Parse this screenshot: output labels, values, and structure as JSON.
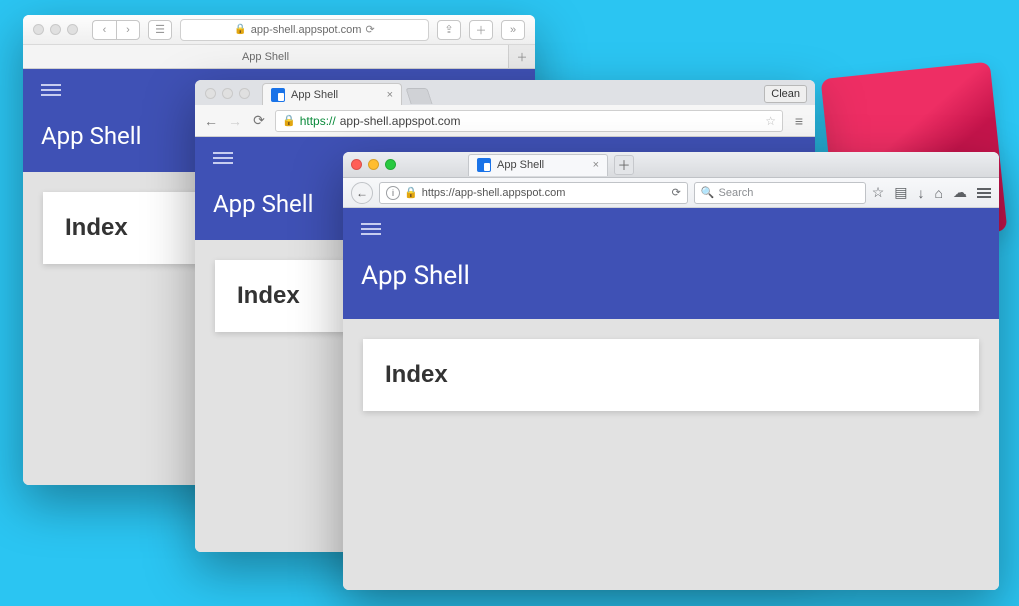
{
  "app": {
    "title": "App Shell",
    "card_heading": "Index"
  },
  "safari": {
    "url_label": "app-shell.appspot.com",
    "tab_label": "App Shell"
  },
  "chrome": {
    "tab_label": "App Shell",
    "clean_label": "Clean",
    "url_https": "https://",
    "url_domain": "app-shell.appspot.com"
  },
  "firefox": {
    "tab_label": "App Shell",
    "url_text": "https://app-shell.appspot.com",
    "search_placeholder": "Search"
  }
}
